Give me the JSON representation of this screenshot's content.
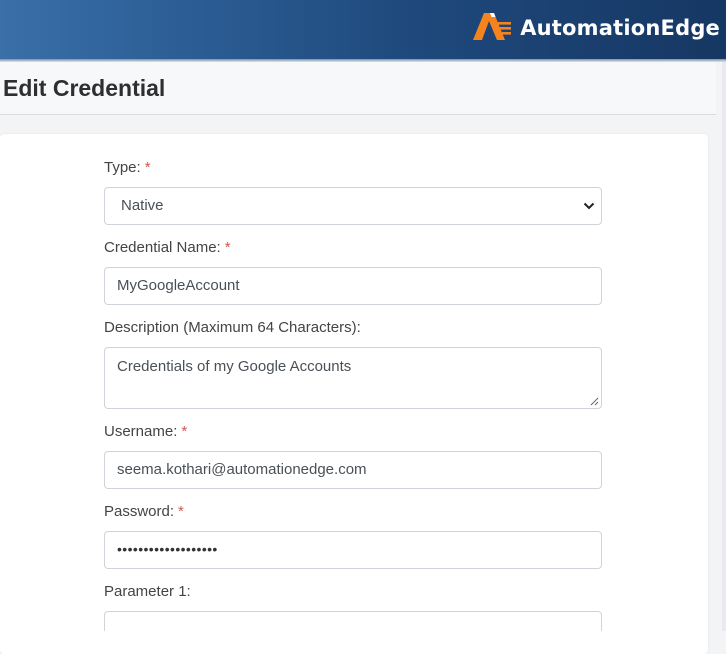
{
  "brand": {
    "name": "AutomationEdge",
    "accent_color": "#f5841f",
    "logo_icon": "automationedge-logo-icon"
  },
  "page": {
    "title": "Edit Credential"
  },
  "form": {
    "type": {
      "label": "Type:",
      "required_marker": "*",
      "value": "Native",
      "icon": "chevron-down-icon"
    },
    "credential_name": {
      "label": "Credential Name:",
      "required_marker": "*",
      "value": "MyGoogleAccount"
    },
    "description": {
      "label": "Description (Maximum 64 Characters):",
      "value": "Credentials of my Google Accounts",
      "icon": "resize-handle-icon"
    },
    "username": {
      "label": "Username:",
      "required_marker": "*",
      "value": "seema.kothari@automationedge.com"
    },
    "password": {
      "label": "Password:",
      "required_marker": "*",
      "masked_value": "•••••••••••••••••••"
    },
    "parameter_1": {
      "label": "Parameter 1:",
      "value": ""
    }
  }
}
